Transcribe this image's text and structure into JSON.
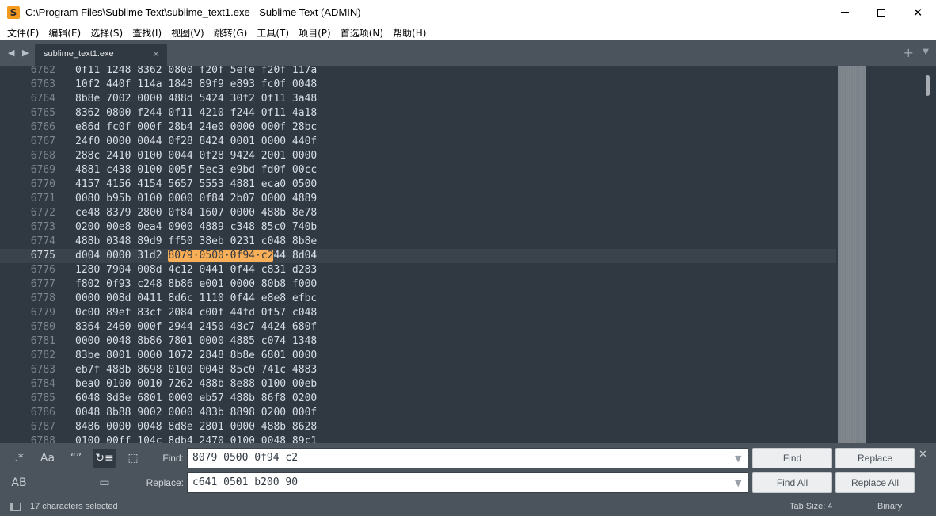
{
  "window": {
    "title": "C:\\Program Files\\Sublime Text\\sublime_text1.exe - Sublime Text (ADMIN)",
    "app_icon_glyph": "S",
    "minimize_glyph": "",
    "close_glyph": "✕"
  },
  "menu": {
    "items": [
      "文件(F)",
      "编辑(E)",
      "选择(S)",
      "查找(I)",
      "视图(V)",
      "跳转(G)",
      "工具(T)",
      "项目(P)",
      "首选项(N)",
      "帮助(H)"
    ]
  },
  "tabs": {
    "nav_arrows": "◀ ▶",
    "active_tab_label": "sublime_text1.exe",
    "close_glyph": "×",
    "new_tab_glyph": "+",
    "dropdown_glyph": "▼"
  },
  "editor": {
    "current_line": "6775",
    "lines": [
      {
        "n": "6762",
        "code": "0f11 1248 8362 0800 f20f 5efe f20f 117a"
      },
      {
        "n": "6763",
        "code": "10f2 440f 114a 1848 89f9 e893 fc0f 0048"
      },
      {
        "n": "6764",
        "code": "8b8e 7002 0000 488d 5424 30f2 0f11 3a48"
      },
      {
        "n": "6765",
        "code": "8362 0800 f244 0f11 4210 f244 0f11 4a18"
      },
      {
        "n": "6766",
        "code": "e86d fc0f 000f 28b4 24e0 0000 000f 28bc"
      },
      {
        "n": "6767",
        "code": "24f0 0000 0044 0f28 8424 0001 0000 440f"
      },
      {
        "n": "6768",
        "code": "288c 2410 0100 0044 0f28 9424 2001 0000"
      },
      {
        "n": "6769",
        "code": "4881 c438 0100 005f 5ec3 e9bd fd0f 00cc"
      },
      {
        "n": "6770",
        "code": "4157 4156 4154 5657 5553 4881 eca0 0500"
      },
      {
        "n": "6771",
        "code": "0080 b95b 0100 0000 0f84 2b07 0000 4889"
      },
      {
        "n": "6772",
        "code": "ce48 8379 2800 0f84 1607 0000 488b 8e78"
      },
      {
        "n": "6773",
        "code": "0200 00e8 0ea4 0900 4889 c348 85c0 740b"
      },
      {
        "n": "6774",
        "code": "488b 0348 89d9 ff50 38eb 0231 c048 8b8e"
      },
      {
        "n": "6775",
        "pre": "d004 0000 31d2 ",
        "match": "8079·0500·0f94·c2",
        "post": "44 8d04"
      },
      {
        "n": "6776",
        "code": "1280 7904 008d 4c12 0441 0f44 c831 d283"
      },
      {
        "n": "6777",
        "code": "f802 0f93 c248 8b86 e001 0000 80b8 f000"
      },
      {
        "n": "6778",
        "code": "0000 008d 0411 8d6c 1110 0f44 e8e8 efbc"
      },
      {
        "n": "6779",
        "code": "0c00 89ef 83cf 2084 c00f 44fd 0f57 c048"
      },
      {
        "n": "6780",
        "code": "8364 2460 000f 2944 2450 48c7 4424 680f"
      },
      {
        "n": "6781",
        "code": "0000 0048 8b86 7801 0000 4885 c074 1348"
      },
      {
        "n": "6782",
        "code": "83be 8001 0000 1072 2848 8b8e 6801 0000"
      },
      {
        "n": "6783",
        "code": "eb7f 488b 8698 0100 0048 85c0 741c 4883"
      },
      {
        "n": "6784",
        "code": "bea0 0100 0010 7262 488b 8e88 0100 00eb"
      },
      {
        "n": "6785",
        "code": "6048 8d8e 6801 0000 eb57 488b 86f8 0200"
      },
      {
        "n": "6786",
        "code": "0048 8b88 9002 0000 483b 8898 0200 000f"
      },
      {
        "n": "6787",
        "code": "8486 0000 0048 8d8e 2801 0000 488b 8628"
      },
      {
        "n": "6788",
        "code": "0100 00ff 104c 8db4 2470 0100 0048 89c1"
      }
    ]
  },
  "find_panel": {
    "options": {
      "regex": ".*",
      "case": "Aa",
      "whole_word": "“”",
      "wrap": "↻≡",
      "in_selection": "⬚",
      "preserve_case": "AB",
      "highlight": "▭"
    },
    "find_label": "Find:",
    "find_value": "8079 0500 0f94 c2",
    "replace_label": "Replace:",
    "replace_value": "c641 0501 b200 90",
    "dropdown_glyph": "▼",
    "find_button": "Find",
    "replace_button": "Replace",
    "find_all_button": "Find All",
    "replace_all_button": "Replace All",
    "close_glyph": "✕"
  },
  "status": {
    "selection": "17 characters selected",
    "tab_size": "Tab Size: 4",
    "syntax": "Binary"
  }
}
